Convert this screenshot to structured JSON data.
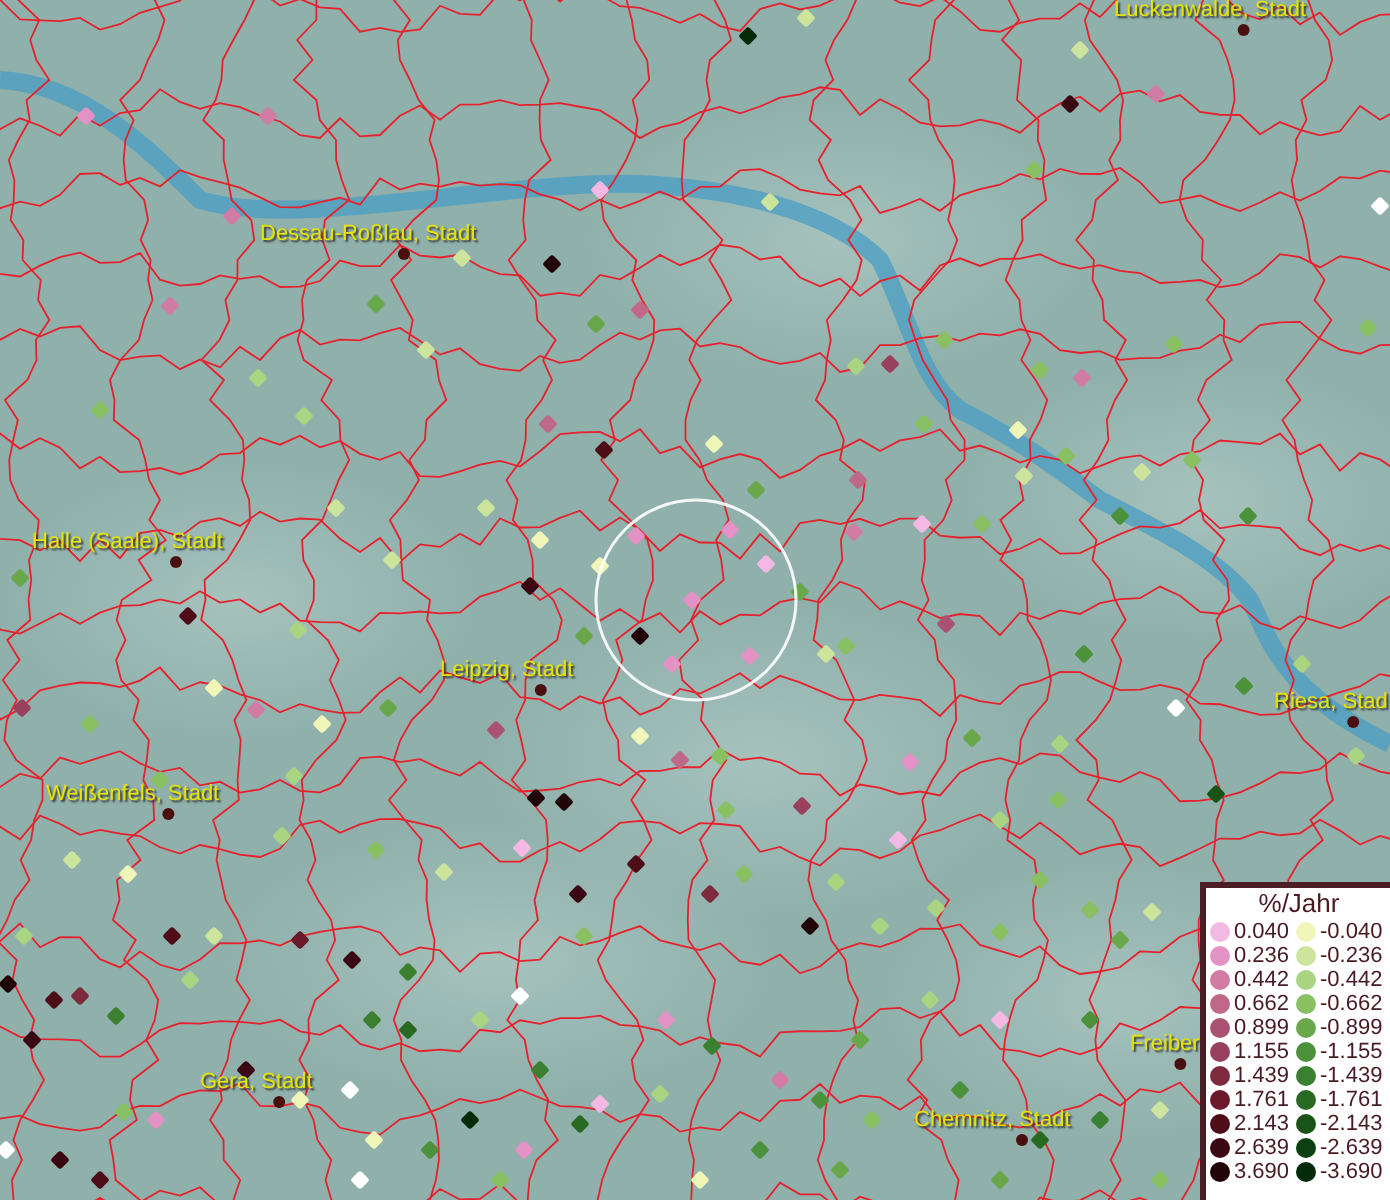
{
  "map": {
    "places": [
      {
        "name": "Luckenwalde, Stadt"
      },
      {
        "name": "Dessau-Roßlau, Stadt"
      },
      {
        "name": "Halle (Saale), Stadt"
      },
      {
        "name": "Leipzig, Stadt"
      },
      {
        "name": "Weißenfels, Stadt"
      },
      {
        "name": "Riesa, Stad"
      },
      {
        "name": "Gera, Stadt"
      },
      {
        "name": "Chemnitz, Stadt"
      },
      {
        "name": "Freiber"
      }
    ]
  },
  "legend": {
    "title": "%/Jahr",
    "rows": [
      {
        "items": [
          {
            "label": "0.040",
            "color": "#f4b8e4"
          },
          {
            "label": "-0.040",
            "color": "#f0f5b8"
          }
        ]
      },
      {
        "items": [
          {
            "label": "0.236",
            "color": "#e292c4"
          },
          {
            "label": "-0.236",
            "color": "#cce49c"
          }
        ]
      },
      {
        "items": [
          {
            "label": "0.442",
            "color": "#d07ca4"
          },
          {
            "label": "-0.442",
            "color": "#aad482"
          }
        ]
      },
      {
        "items": [
          {
            "label": "0.662",
            "color": "#c06888"
          },
          {
            "label": "-0.662",
            "color": "#88c062"
          }
        ]
      },
      {
        "items": [
          {
            "label": "0.899",
            "color": "#aa5272"
          },
          {
            "label": "-0.899",
            "color": "#68a84a"
          }
        ]
      },
      {
        "items": [
          {
            "label": "1.155",
            "color": "#98405c"
          },
          {
            "label": "-1.155",
            "color": "#4c923a"
          }
        ]
      },
      {
        "items": [
          {
            "label": "1.439",
            "color": "#7c2a3c"
          },
          {
            "label": "-1.439",
            "color": "#3a8030"
          }
        ]
      },
      {
        "items": [
          {
            "label": "1.761",
            "color": "#6a1a2a"
          },
          {
            "label": "-1.761",
            "color": "#286a22"
          }
        ]
      },
      {
        "items": [
          {
            "label": "2.143",
            "color": "#4e0e18"
          },
          {
            "label": "-2.143",
            "color": "#185418"
          }
        ]
      },
      {
        "items": [
          {
            "label": "2.639",
            "color": "#3a0812"
          },
          {
            "label": "-2.639",
            "color": "#0c4010"
          }
        ]
      },
      {
        "items": [
          {
            "label": "3.690",
            "color": "#200408"
          },
          {
            "label": "-3.690",
            "color": "#052a08"
          }
        ]
      }
    ]
  }
}
